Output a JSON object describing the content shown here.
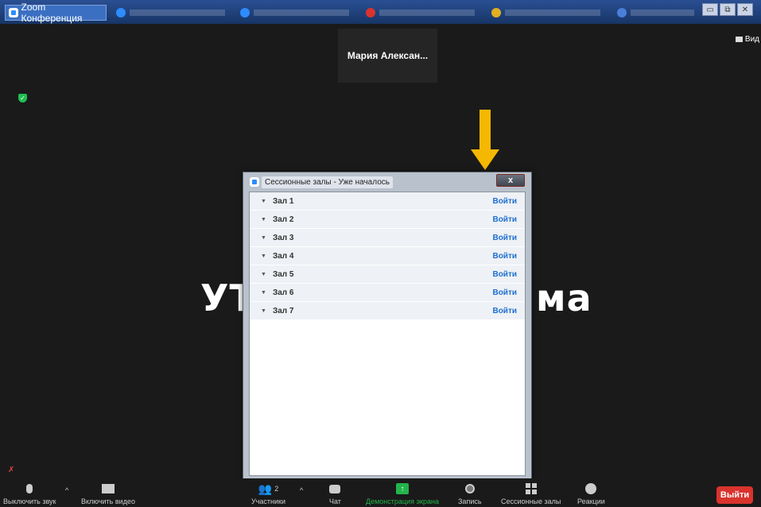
{
  "taskbar": {
    "window_title": "Zoom Конференция",
    "task_items": [
      {
        "label": "",
        "color": "#2d8cff"
      },
      {
        "label": "",
        "color": "#2d8cff"
      },
      {
        "label": "",
        "color": "#d9332d"
      },
      {
        "label": "",
        "color": "#e0b020"
      },
      {
        "label": "",
        "color": "#4a7fd8"
      }
    ],
    "window_buttons": [
      "minimize",
      "restore",
      "close"
    ]
  },
  "meeting": {
    "participant_name": "Мария  Алексан...",
    "view_label": "Вид",
    "background_text_left": "УТ",
    "background_text_right": "ма"
  },
  "dialog": {
    "title": "Сессионные залы - Уже началось",
    "close_label": "x",
    "rooms": [
      {
        "name": "Зал 1",
        "action": "Войти"
      },
      {
        "name": "Зал 2",
        "action": "Войти"
      },
      {
        "name": "Зал 3",
        "action": "Войти"
      },
      {
        "name": "Зал 4",
        "action": "Войти"
      },
      {
        "name": "Зал 5",
        "action": "Войти"
      },
      {
        "name": "Зал 6",
        "action": "Войти"
      },
      {
        "name": "Зал 7",
        "action": "Войти"
      }
    ]
  },
  "toolbar": {
    "mute": "Выключить звук",
    "video": "Включить видео",
    "participants": "Участники",
    "participants_count": "2",
    "chat": "Чат",
    "share": "Демонстрация экрана",
    "record": "Запись",
    "breakout": "Сессионные залы",
    "reactions": "Реакции",
    "leave": "Выйти"
  },
  "colors": {
    "background": "#1a1a1a",
    "share_green": "#22b44a",
    "leave_red": "#d9332d",
    "join_blue": "#1d6fd0",
    "arrow": "#f5b800"
  }
}
